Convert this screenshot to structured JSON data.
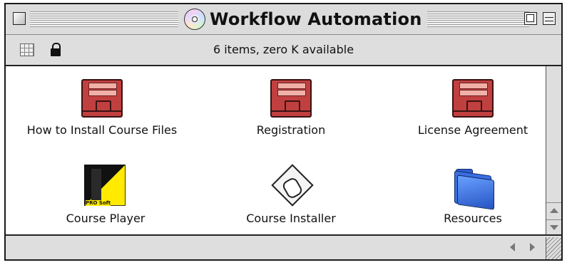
{
  "window": {
    "title": "Workflow Automation",
    "title_icon": "cd-disc-icon"
  },
  "header": {
    "status": "6 items, zero K available"
  },
  "items": [
    {
      "label": "How to Install Course Files",
      "icon": "archive-icon"
    },
    {
      "label": "Registration",
      "icon": "archive-icon"
    },
    {
      "label": "License Agreement",
      "icon": "archive-icon"
    },
    {
      "label": "Course Player",
      "icon": "application-icon"
    },
    {
      "label": "Course Installer",
      "icon": "installer-icon"
    },
    {
      "label": "Resources",
      "icon": "folder-icon"
    }
  ],
  "player_icon_text": "PRO Soft"
}
